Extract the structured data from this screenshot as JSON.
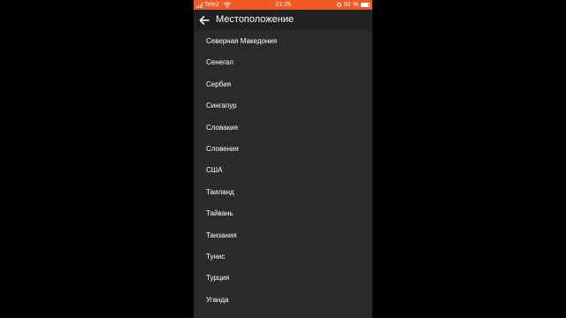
{
  "status_bar": {
    "carrier": "Tele2",
    "time": "21:25",
    "battery_text": "91 %",
    "battery_level": 0.91,
    "background_color": "#f25a24",
    "icons": [
      "signal-icon",
      "wifi-icon",
      "alarm-icon",
      "battery-icon"
    ]
  },
  "header": {
    "title": "Местоположение",
    "back_icon": "arrow-left-icon"
  },
  "countries": [
    "Северная Македония",
    "Сенегал",
    "Сербия",
    "Сингапур",
    "Словакия",
    "Словения",
    "США",
    "Таиланд",
    "Тайвань",
    "Танзания",
    "Тунис",
    "Турция",
    "Уганда"
  ],
  "colors": {
    "accent": "#f25a24",
    "list_background": "#2b2b2b",
    "header_background": "#212121",
    "text": "#ffffff"
  }
}
